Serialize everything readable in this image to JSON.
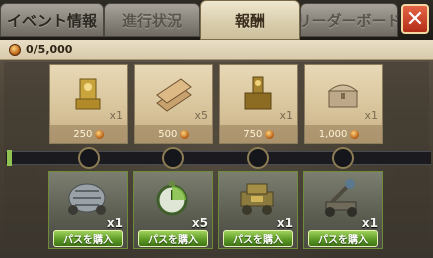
{
  "tabs": [
    {
      "label": "イベント情報",
      "active": false
    },
    {
      "label": "進行状況",
      "active": false
    },
    {
      "label": "報酬",
      "active": true
    },
    {
      "label": "リーダーボード",
      "active": false
    }
  ],
  "close_symbol": "✕",
  "progress": {
    "text": "0/5,000",
    "icon": "coin-icon"
  },
  "rewards": [
    {
      "icon": "golden-treasure-icon",
      "qty": "x1",
      "cost": "250"
    },
    {
      "icon": "lumber-bundle-icon",
      "qty": "x5",
      "cost": "500"
    },
    {
      "icon": "golden-tower-icon",
      "qty": "x1",
      "cost": "750"
    },
    {
      "icon": "treasure-chest-icon",
      "qty": "x1",
      "cost": "1,000"
    }
  ],
  "passes": [
    {
      "icon": "armored-cart-icon",
      "qty": "x1",
      "button": "パスを購入"
    },
    {
      "icon": "stopwatch-speedup-icon",
      "qty": "x5",
      "button": "パスを購入"
    },
    {
      "icon": "siege-wagon-icon",
      "qty": "x1",
      "button": "パスを購入"
    },
    {
      "icon": "catapult-icon",
      "qty": "x1",
      "button": "パスを購入"
    }
  ],
  "colors": {
    "accent_green": "#5e9b26",
    "close_red": "#c23b1f",
    "active_tab": "#e3d7b8"
  }
}
